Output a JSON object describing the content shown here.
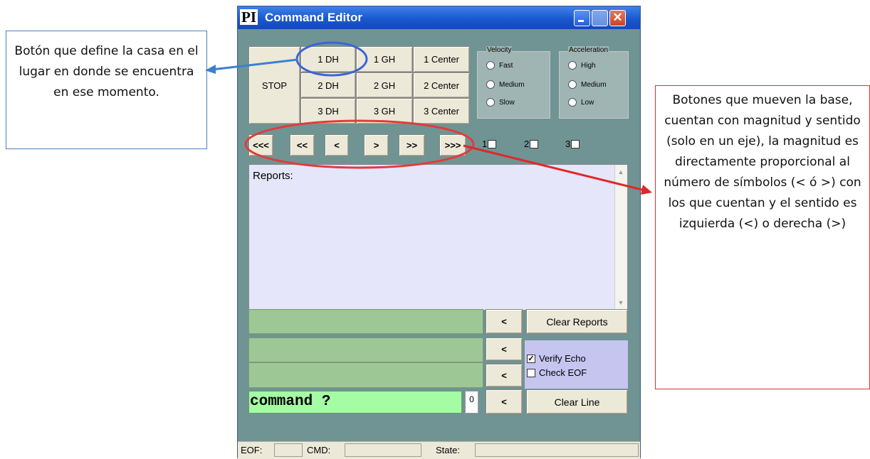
{
  "window": {
    "logo": "PI",
    "title": "Command Editor",
    "close_glyph": "✕"
  },
  "home_row": {
    "stop": "STOP"
  },
  "buttons": [
    [
      "1 DH",
      "1 GH",
      "1 Center"
    ],
    [
      "2 DH",
      "2 GH",
      "2 Center"
    ],
    [
      "3 DH",
      "3 GH",
      "3 Center"
    ]
  ],
  "velocity": {
    "title": "Velocity",
    "options": [
      "Fast",
      "Medium",
      "Slow"
    ]
  },
  "acceleration": {
    "title": "Acceleration",
    "options": [
      "High",
      "Medium",
      "Low"
    ]
  },
  "move_buttons": [
    "<<<",
    "<<",
    "<",
    ">",
    ">>",
    ">>>"
  ],
  "axes": [
    "1",
    "2",
    "3"
  ],
  "reports": {
    "label": "Reports:",
    "scroll_up": "▲",
    "scroll_down": "▼"
  },
  "history": {
    "recall": "<",
    "clear_reports": "Clear Reports",
    "clear_line": "Clear Line"
  },
  "options": {
    "verify_echo": "Verify Echo",
    "verify_echo_checked": true,
    "check_eof": "Check EOF",
    "check_eof_checked": false
  },
  "command": {
    "text": "command ?",
    "counter": "0"
  },
  "status": {
    "eof": "EOF:",
    "cmd": "CMD:",
    "state": "State:"
  },
  "annotations": {
    "left": "Botón que define la casa en el lugar en donde se encuentra en ese momento.",
    "right": "Botones que mueven la base, cuentan con magnitud y sentido (solo en un eje), la magnitud es directamente proporcional al número de símbolos (< ó >) con los que cuentan y el sentido es izquierda (<) o derecha (>)",
    "left_color": "#4a7fc0",
    "right_color": "#e03030"
  }
}
